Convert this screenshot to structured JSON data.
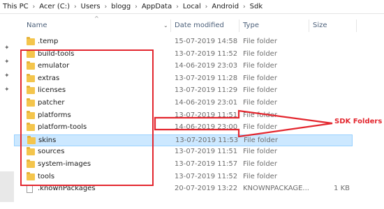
{
  "breadcrumb": [
    "This PC",
    "Acer (C:)",
    "Users",
    "blogg",
    "AppData",
    "Local",
    "Android",
    "Sdk"
  ],
  "columns": {
    "name": "Name",
    "modified": "Date modified",
    "type": "Type",
    "size": "Size"
  },
  "icons": {
    "folder": "folder-icon",
    "file": "file-icon",
    "pin": "pin-icon",
    "sort": "sort-up-icon",
    "separator": "chevron-right-icon"
  },
  "files": [
    {
      "name": ".temp",
      "date": "15-07-2019 14:58",
      "type": "File folder",
      "size": "",
      "kind": "folder"
    },
    {
      "name": "build-tools",
      "date": "13-07-2019 11:52",
      "type": "File folder",
      "size": "",
      "kind": "folder"
    },
    {
      "name": "emulator",
      "date": "14-06-2019 23:03",
      "type": "File folder",
      "size": "",
      "kind": "folder"
    },
    {
      "name": "extras",
      "date": "13-07-2019 11:28",
      "type": "File folder",
      "size": "",
      "kind": "folder"
    },
    {
      "name": "licenses",
      "date": "13-07-2019 11:29",
      "type": "File folder",
      "size": "",
      "kind": "folder"
    },
    {
      "name": "patcher",
      "date": "14-06-2019 23:01",
      "type": "File folder",
      "size": "",
      "kind": "folder"
    },
    {
      "name": "platforms",
      "date": "13-07-2019 11:51",
      "type": "File folder",
      "size": "",
      "kind": "folder"
    },
    {
      "name": "platform-tools",
      "date": "14-06-2019 23:00",
      "type": "File folder",
      "size": "",
      "kind": "folder"
    },
    {
      "name": "skins",
      "date": "13-07-2019 11:53",
      "type": "File folder",
      "size": "",
      "kind": "folder",
      "selected": true
    },
    {
      "name": "sources",
      "date": "13-07-2019 11:51",
      "type": "File folder",
      "size": "",
      "kind": "folder"
    },
    {
      "name": "system-images",
      "date": "13-07-2019 11:57",
      "type": "File folder",
      "size": "",
      "kind": "folder"
    },
    {
      "name": "tools",
      "date": "13-07-2019 11:52",
      "type": "File folder",
      "size": "",
      "kind": "folder"
    },
    {
      "name": ".knownPackages",
      "date": "20-07-2019 13:22",
      "type": "KNOWNPACKAGE...",
      "size": "1 KB",
      "kind": "file"
    }
  ],
  "annotation": {
    "label": "SDK Folders",
    "color": "#e3262e"
  },
  "colors": {
    "selection": "#cce8ff",
    "selection_border": "#99d1ff",
    "folder": "#f4c54c",
    "header_text": "#4c607a"
  }
}
